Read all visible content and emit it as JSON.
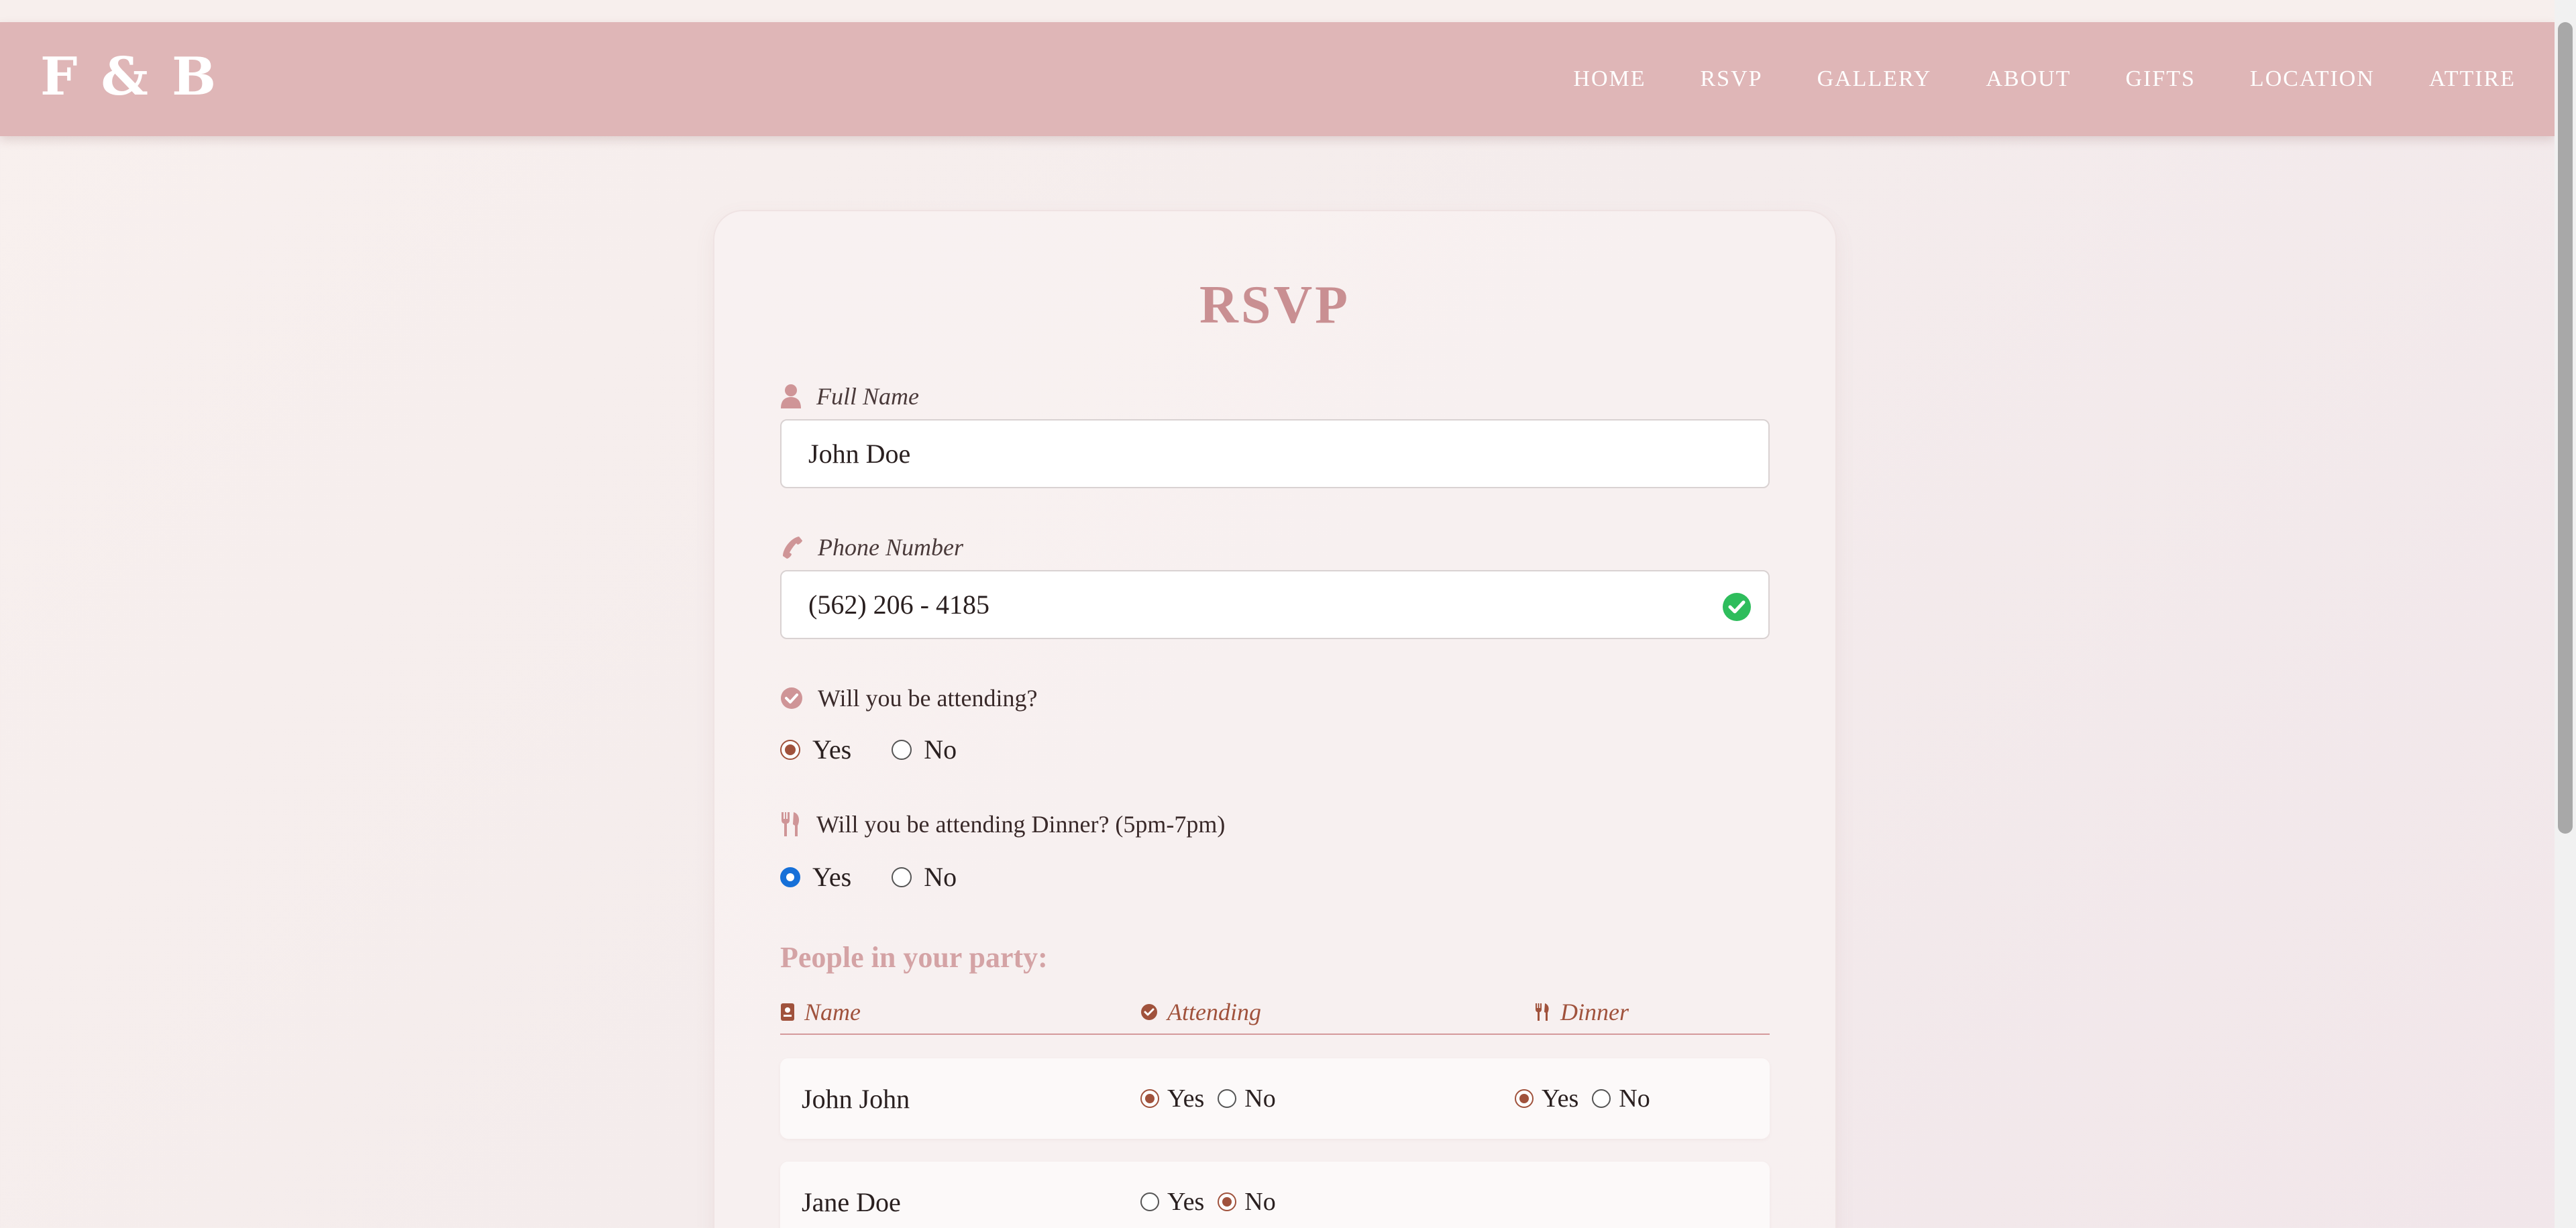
{
  "brand": {
    "logo": "F & B"
  },
  "nav": {
    "items": [
      {
        "label": "HOME"
      },
      {
        "label": "RSVP"
      },
      {
        "label": "GALLERY"
      },
      {
        "label": "ABOUT"
      },
      {
        "label": "GIFTS"
      },
      {
        "label": "LOCATION"
      },
      {
        "label": "ATTIRE"
      }
    ]
  },
  "form": {
    "title": "RSVP",
    "full_name": {
      "label": "Full Name",
      "value": "John Doe",
      "icon": "user-icon"
    },
    "phone": {
      "label": "Phone Number",
      "value": "(562) 206 - 4185",
      "icon": "phone-icon",
      "status": "valid"
    },
    "attending": {
      "label": "Will you be attending?",
      "yes": "Yes",
      "no": "No",
      "selected": "Yes",
      "icon": "check-circle-icon"
    },
    "dinner": {
      "label": "Will you be attending Dinner? (5pm-7pm)",
      "yes": "Yes",
      "no": "No",
      "selected": "Yes",
      "icon": "utensils-icon"
    }
  },
  "party": {
    "heading": "People in your party:",
    "columns": {
      "name": "Name",
      "attending": "Attending",
      "dinner": "Dinner"
    },
    "rows": [
      {
        "name": "John John",
        "attending": "Yes",
        "dinner": "Yes",
        "yes": "Yes",
        "no": "No"
      },
      {
        "name": "Jane Doe",
        "attending": "No",
        "dinner": null,
        "yes": "Yes",
        "no": "No"
      }
    ]
  },
  "colors": {
    "navbar": "#dfb6b7",
    "title": "#c98f92",
    "accent_brown": "#a0523c",
    "valid_green": "#2ebd5c",
    "radio_blue": "#1670d8"
  }
}
